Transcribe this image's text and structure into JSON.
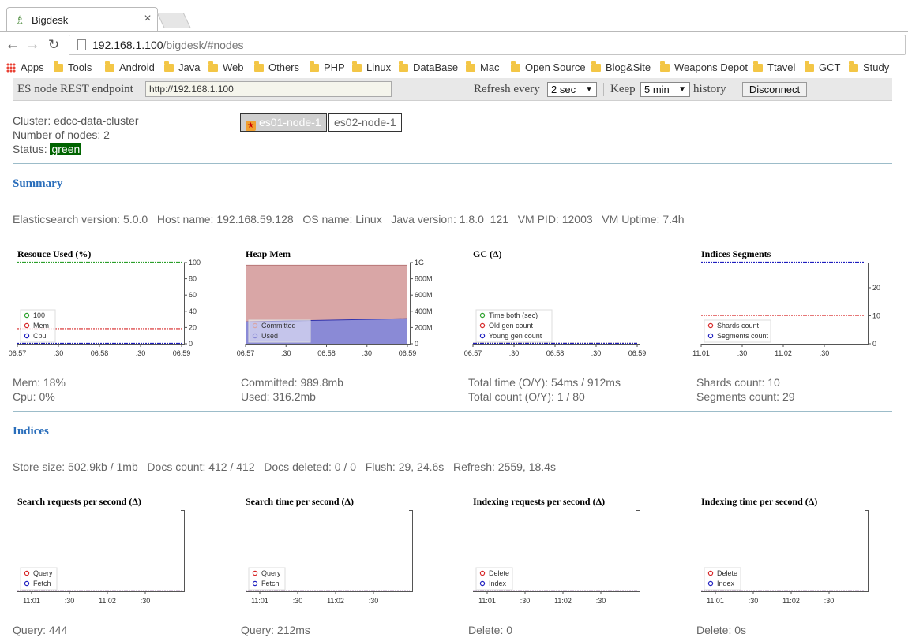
{
  "browser": {
    "tab_title": "Bigdesk",
    "tab_close": "×",
    "url": "192.168.1.100/bigdesk/#nodes",
    "url_host": "192.168.1.100",
    "url_path": "/bigdesk/#nodes",
    "bookmarks": [
      "Apps",
      "Tools",
      "Android",
      "Java",
      "Web",
      "Others",
      "PHP",
      "Linux",
      "DataBase",
      "Mac",
      "Open Source",
      "Blog&Site",
      "Weapons Depot",
      "Ttavel",
      "GCT",
      "Study"
    ]
  },
  "header": {
    "endpoint_label": "ES node REST endpoint",
    "endpoint_value": "http://192.168.1.100",
    "refresh_label": "Refresh every",
    "refresh_value": "2 sec",
    "keep_label": "Keep",
    "keep_value": "5 min",
    "history_label": "history",
    "disconnect_label": "Disconnect"
  },
  "cluster": {
    "name_line": "Cluster: edcc-data-cluster",
    "nodes_line": "Number of nodes: 2",
    "status_label": "Status:",
    "status_value": "green",
    "status_color": "#006400",
    "nodes": [
      "es01-node-1",
      "es02-node-1"
    ]
  },
  "summary": {
    "title": "Summary",
    "info": "Elasticsearch version: 5.0.0   Host name: 192.168.59.128   OS name: Linux   Java version: 1.8.0_121   VM PID: 12003   VM Uptime: 7.4h",
    "stats": [
      [
        "Mem: 18%",
        "Cpu: 0%"
      ],
      [
        "Committed: 989.8mb",
        "Used: 316.2mb"
      ],
      [
        "Total time (O/Y): 54ms / 912ms",
        "Total count (O/Y): 1 / 80"
      ],
      [
        "Shards count: 10",
        "Segments count: 29"
      ]
    ]
  },
  "indices": {
    "title": "Indices",
    "info": "Store size: 502.9kb / 1mb   Docs count: 412 / 412   Docs deleted: 0 / 0   Flush: 29, 24.6s   Refresh: 2559, 18.4s",
    "stats": [
      "Query: 444",
      "Query: 212ms",
      "Delete: 0",
      "Delete: 0s"
    ]
  },
  "chart_data": [
    {
      "type": "line",
      "title": "Resouce Used (%)",
      "x": [
        "06:57",
        ":30",
        "06:58",
        ":30",
        "06:59"
      ],
      "yticks": [
        "100",
        "80",
        "60",
        "40",
        "20",
        "0"
      ],
      "ylim": [
        0,
        100
      ],
      "series": [
        {
          "name": "100",
          "color": "#2ca02c",
          "values": [
            100,
            100,
            100,
            100,
            100
          ]
        },
        {
          "name": "Mem",
          "color": "#d62728",
          "values": [
            18,
            18,
            18,
            18,
            18
          ]
        },
        {
          "name": "Cpu",
          "color": "#1f1fbf",
          "values": [
            0,
            0,
            0,
            0,
            0
          ]
        }
      ]
    },
    {
      "type": "area",
      "title": "Heap Mem",
      "x": [
        "06:57",
        ":30",
        "06:58",
        ":30",
        "06:59"
      ],
      "yticks": [
        "1G",
        "800M",
        "600M",
        "400M",
        "200M",
        "0"
      ],
      "ylim": [
        0,
        1.0
      ],
      "series": [
        {
          "name": "Committed",
          "color": "#d9a6a6",
          "values": [
            0.967,
            0.967,
            0.967,
            0.967,
            0.967
          ]
        },
        {
          "name": "Used",
          "color": "#8a8ad6",
          "values": [
            0.27,
            0.28,
            0.29,
            0.3,
            0.309
          ]
        }
      ]
    },
    {
      "type": "line",
      "title": "GC (Δ)",
      "x": [
        "06:57",
        ":30",
        "06:58",
        ":30",
        "06:59"
      ],
      "yticks": [],
      "ylim": [
        0,
        1
      ],
      "series": [
        {
          "name": "Time both (sec)",
          "color": "#2ca02c",
          "values": [
            0,
            0,
            0,
            0,
            0
          ]
        },
        {
          "name": "Old gen count",
          "color": "#d62728",
          "values": [
            0,
            0,
            0,
            0,
            0
          ]
        },
        {
          "name": "Young gen count",
          "color": "#1f1fbf",
          "values": [
            0,
            0,
            0,
            0,
            0
          ]
        }
      ]
    },
    {
      "type": "line",
      "title": "Indices Segments",
      "x": [
        "11:01",
        ":30",
        "11:02",
        ":30"
      ],
      "yticks": [
        "20",
        "10",
        "0"
      ],
      "ylim": [
        0,
        29
      ],
      "series": [
        {
          "name": "Shards count",
          "color": "#d62728",
          "values": [
            10,
            10,
            10,
            10
          ]
        },
        {
          "name": "Segments count",
          "color": "#1f1fbf",
          "values": [
            29,
            29,
            29,
            29
          ]
        }
      ]
    },
    {
      "type": "line",
      "title": "Search requests per second (Δ)",
      "x": [
        "11:01",
        ":30",
        "11:02",
        ":30"
      ],
      "yticks": [],
      "ylim": [
        0,
        1
      ],
      "series": [
        {
          "name": "Query",
          "color": "#d62728",
          "values": [
            0,
            0,
            0,
            0
          ]
        },
        {
          "name": "Fetch",
          "color": "#1f1fbf",
          "values": [
            0,
            0,
            0,
            0
          ]
        }
      ]
    },
    {
      "type": "line",
      "title": "Search time per second (Δ)",
      "x": [
        "11:01",
        ":30",
        "11:02",
        ":30"
      ],
      "yticks": [],
      "ylim": [
        0,
        1
      ],
      "series": [
        {
          "name": "Query",
          "color": "#d62728",
          "values": [
            0,
            0,
            0,
            0
          ]
        },
        {
          "name": "Fetch",
          "color": "#1f1fbf",
          "values": [
            0,
            0,
            0,
            0
          ]
        }
      ]
    },
    {
      "type": "line",
      "title": "Indexing requests per second (Δ)",
      "x": [
        "11:01",
        ":30",
        "11:02",
        ":30"
      ],
      "yticks": [],
      "ylim": [
        0,
        1
      ],
      "series": [
        {
          "name": "Delete",
          "color": "#d62728",
          "values": [
            0,
            0,
            0,
            0
          ]
        },
        {
          "name": "Index",
          "color": "#1f1fbf",
          "values": [
            0,
            0,
            0,
            0
          ]
        }
      ]
    },
    {
      "type": "line",
      "title": "Indexing time per second (Δ)",
      "x": [
        "11:01",
        ":30",
        "11:02",
        ":30"
      ],
      "yticks": [],
      "ylim": [
        0,
        1
      ],
      "series": [
        {
          "name": "Delete",
          "color": "#d62728",
          "values": [
            0,
            0,
            0,
            0
          ]
        },
        {
          "name": "Index",
          "color": "#1f1fbf",
          "values": [
            0,
            0,
            0,
            0
          ]
        }
      ]
    }
  ]
}
